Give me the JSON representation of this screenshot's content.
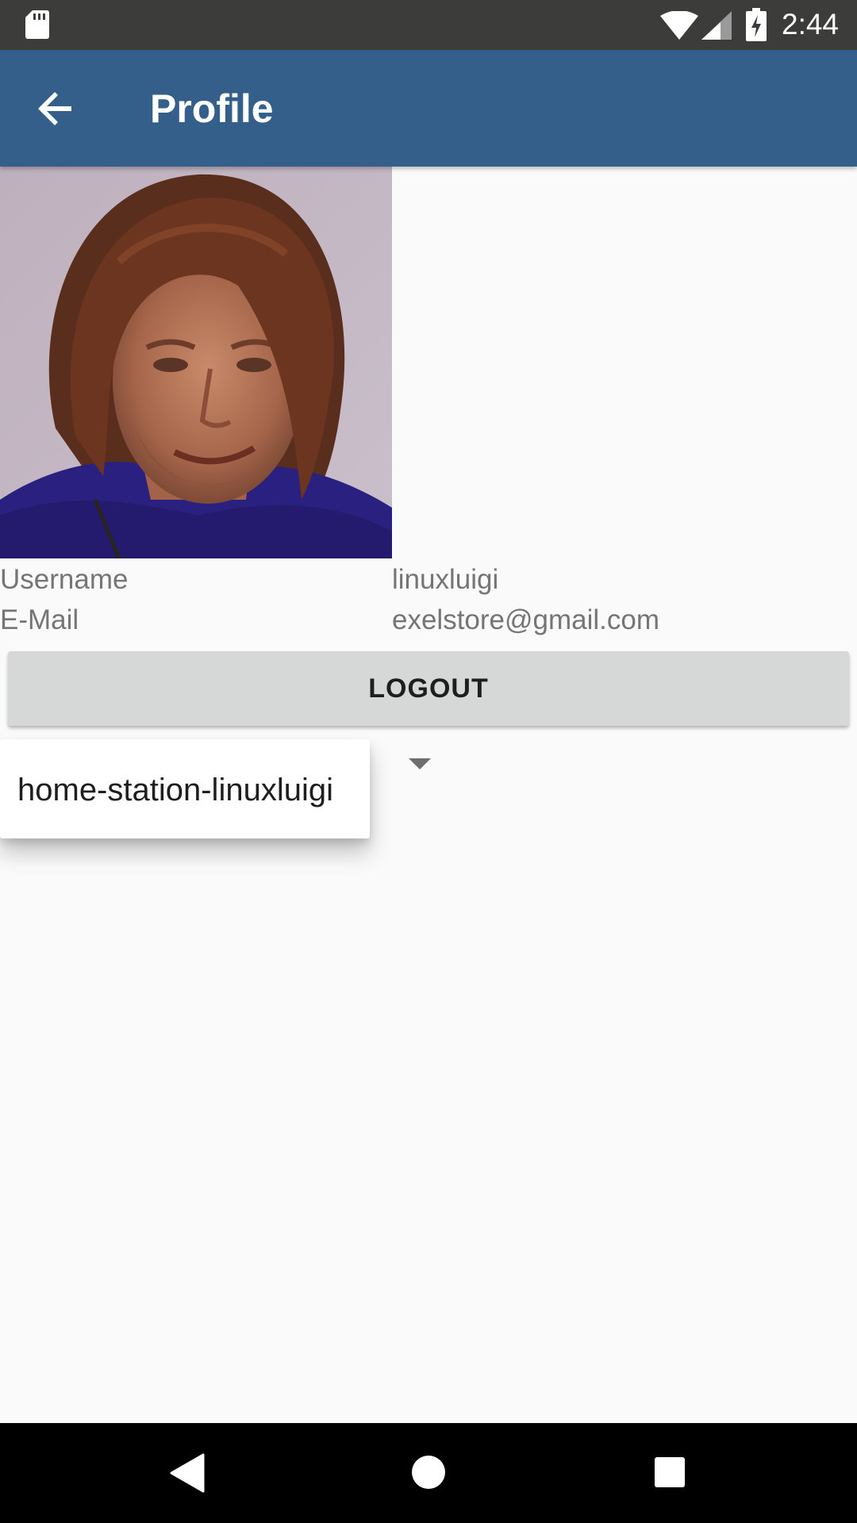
{
  "status_bar": {
    "time": "2:44",
    "icons": [
      "sd-card-icon",
      "wifi-icon",
      "cell-signal-icon",
      "battery-charging-icon"
    ]
  },
  "app_bar": {
    "title": "Profile",
    "back_icon": "arrow-back-icon"
  },
  "profile": {
    "username_label": "Username",
    "username_value": "linuxluigi",
    "email_label": "E-Mail",
    "email_value": "exelstore@gmail.com"
  },
  "actions": {
    "logout_label": "LOGOUT"
  },
  "spinner": {
    "options": [
      "home-station-linuxluigi"
    ]
  },
  "nav_bar": {
    "icons": [
      "nav-back-icon",
      "nav-home-icon",
      "nav-recents-icon"
    ]
  },
  "colors": {
    "status_bar": "#3c3c3a",
    "app_bar": "#335f8a",
    "background": "#fafafa",
    "button": "#d6d7d7",
    "secondary_text": "#757575"
  }
}
